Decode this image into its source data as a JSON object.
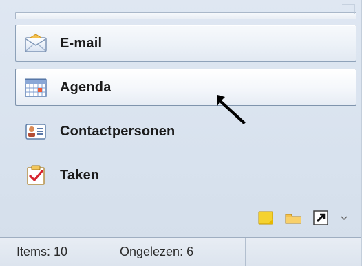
{
  "nav_items": [
    {
      "label": "E-mail",
      "icon": "envelope-icon",
      "state": "selected"
    },
    {
      "label": "Agenda",
      "icon": "calendar-icon",
      "state": "current"
    },
    {
      "label": "Contactpersonen",
      "icon": "contact-card-icon",
      "state": "normal"
    },
    {
      "label": "Taken",
      "icon": "tasks-checkbox-icon",
      "state": "normal"
    }
  ],
  "bottom_tools": [
    {
      "icon": "notes-icon"
    },
    {
      "icon": "folder-icon"
    },
    {
      "icon": "shortcut-icon"
    },
    {
      "icon": "chevron-down-icon"
    }
  ],
  "status": {
    "items": "Items: 10",
    "unread": "Ongelezen: 6"
  },
  "colors": {
    "panel_bg": "#dfe7f2",
    "selected_border": "#8ea2b9",
    "text": "#1b1b1b"
  }
}
